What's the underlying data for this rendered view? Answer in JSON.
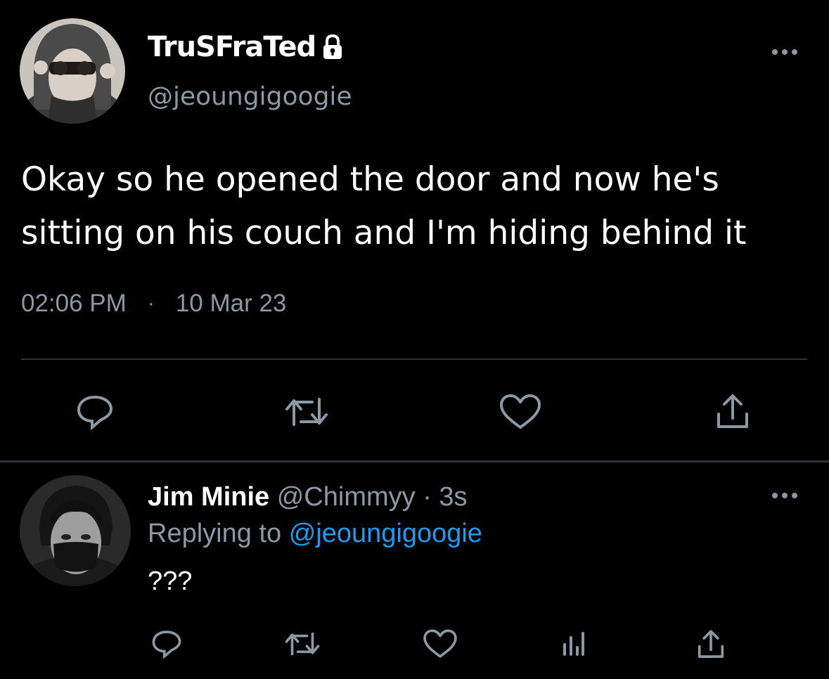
{
  "tweet": {
    "author": {
      "display_name": "TruSFraTed",
      "handle": "@jeoungigoogie",
      "protected_icon": "lock-icon"
    },
    "text": "Okay so he opened the door and now he's sitting on his couch and I'm hiding behind it",
    "time": "02:06 PM",
    "separator": "·",
    "date": "10 Mar 23",
    "actions": [
      "reply-icon",
      "retweet-icon",
      "like-icon",
      "share-icon"
    ]
  },
  "reply": {
    "author": {
      "display_name": "Jim Minie",
      "handle": "@Chimmyy",
      "separator": "·",
      "time": "3s"
    },
    "replying_prefix": "Replying to",
    "replying_to": "@jeoungigoogie",
    "text": "???",
    "actions": [
      "reply-icon",
      "retweet-icon",
      "like-icon",
      "analytics-icon",
      "share-icon"
    ]
  },
  "colors": {
    "background": "#000000",
    "text": "#ffffff",
    "secondary": "#8b98a5",
    "link": "#1d9bf0",
    "divider": "#2f3336"
  }
}
